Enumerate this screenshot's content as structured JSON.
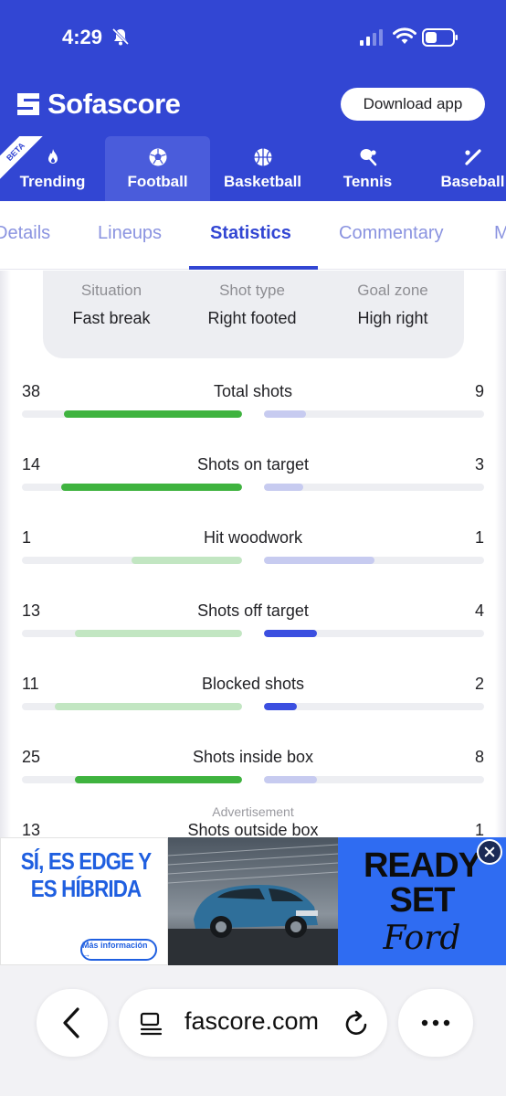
{
  "status_bar": {
    "time": "4:29"
  },
  "header": {
    "brand": "Sofascore",
    "download_label": "Download app",
    "beta_label": "BETA"
  },
  "sports": [
    {
      "label": "Trending",
      "icon": "flame-icon"
    },
    {
      "label": "Football",
      "icon": "football-icon",
      "active": true
    },
    {
      "label": "Basketball",
      "icon": "basketball-icon"
    },
    {
      "label": "Tennis",
      "icon": "tennis-icon"
    },
    {
      "label": "Baseball",
      "icon": "baseball-icon"
    }
  ],
  "tabs": [
    {
      "label": "Details"
    },
    {
      "label": "Lineups"
    },
    {
      "label": "Statistics",
      "active": true
    },
    {
      "label": "Commentary"
    },
    {
      "label": "M"
    }
  ],
  "shot_info": [
    {
      "key": "Situation",
      "value": "Fast break"
    },
    {
      "key": "Shot type",
      "value": "Right footed"
    },
    {
      "key": "Goal zone",
      "value": "High right"
    }
  ],
  "colors": {
    "brand": "#3246d3",
    "home_strong": "#3fb33f",
    "home_weak": "#c2e6c2",
    "away_strong": "#3b4fe0",
    "away_weak": "#c7cbf0"
  },
  "stats": [
    {
      "name": "Total shots",
      "home": "38",
      "away": "9",
      "home_frac": 0.81,
      "away_frac": 0.19,
      "leader": "home"
    },
    {
      "name": "Shots on target",
      "home": "14",
      "away": "3",
      "home_frac": 0.82,
      "away_frac": 0.18,
      "leader": "home"
    },
    {
      "name": "Hit woodwork",
      "home": "1",
      "away": "1",
      "home_frac": 0.5,
      "away_frac": 0.5,
      "leader": "none"
    },
    {
      "name": "Shots off target",
      "home": "13",
      "away": "4",
      "home_frac": 0.76,
      "away_frac": 0.24,
      "leader": "away"
    },
    {
      "name": "Blocked shots",
      "home": "11",
      "away": "2",
      "home_frac": 0.85,
      "away_frac": 0.15,
      "leader": "away"
    },
    {
      "name": "Shots inside box",
      "home": "25",
      "away": "8",
      "home_frac": 0.76,
      "away_frac": 0.24,
      "leader": "home"
    },
    {
      "name": "Shots outside box",
      "home": "13",
      "away": "1"
    }
  ],
  "ad": {
    "label": "Advertisement",
    "headline": "SÍ, ES EDGE Y ES HÍBRIDA",
    "more_info": "Más información →",
    "ready": "READY SET",
    "brand": "Ford"
  },
  "browser": {
    "url": "fascore.com"
  }
}
